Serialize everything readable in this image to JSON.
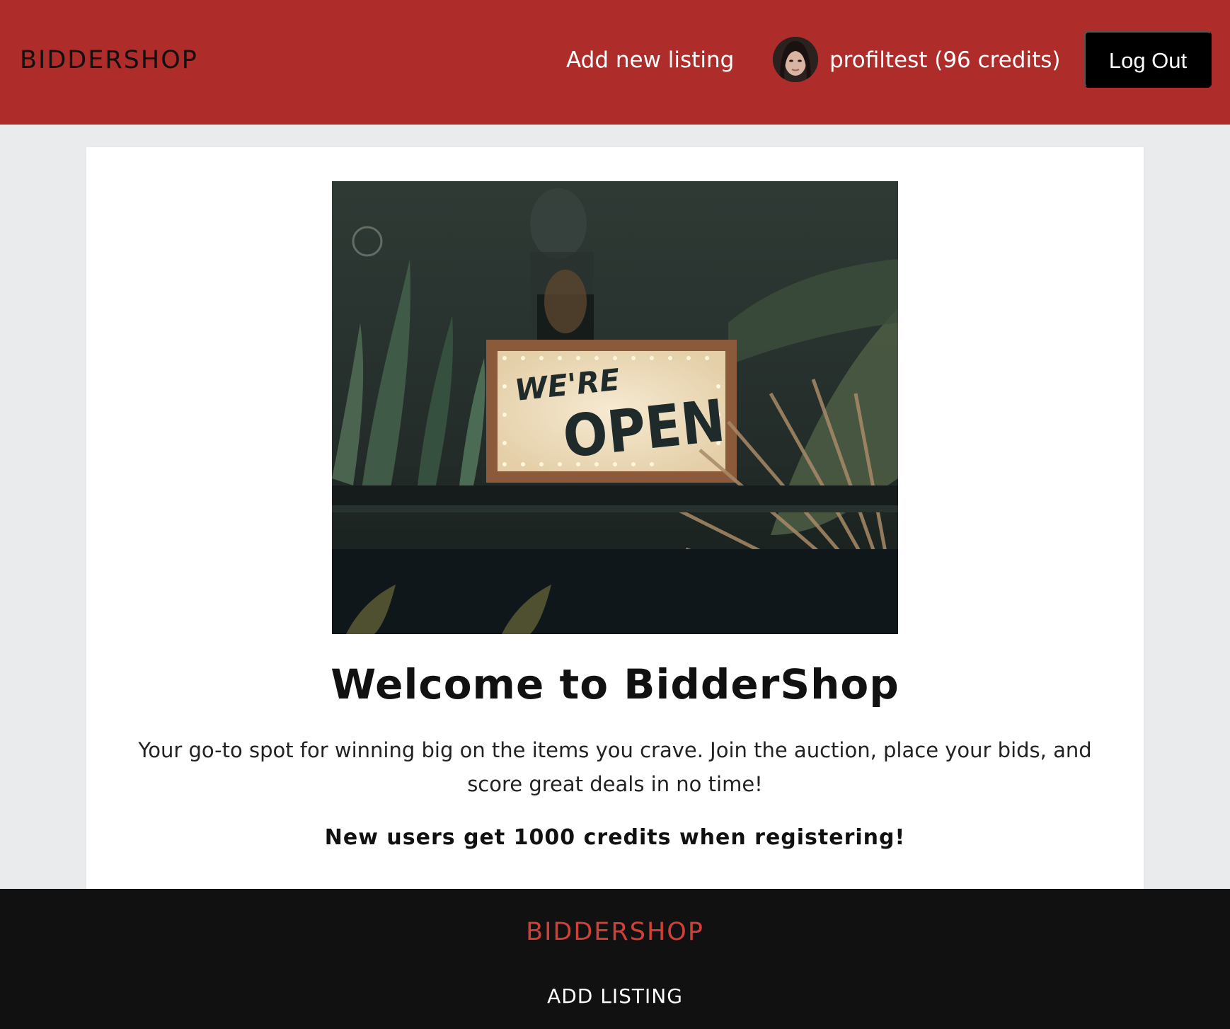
{
  "header": {
    "brand": "BIDDERSHOP",
    "nav_add_listing": "Add new listing",
    "username": "profiltest (96 credits)",
    "logout_label": "Log Out",
    "background_color": "#ae2c29"
  },
  "hero": {
    "image_sign_line1": "WE'RE",
    "image_sign_line2": "OPEN",
    "title": "Welcome to BidderShop",
    "description": "Your go-to spot for winning big on the items you crave. Join the auction, place your bids, and score great deals in no time!",
    "promo": "New users get 1000 credits when registering!"
  },
  "footer": {
    "brand": "BIDDERSHOP",
    "add_listing": "ADD LISTING",
    "brand_color": "#d14036"
  }
}
